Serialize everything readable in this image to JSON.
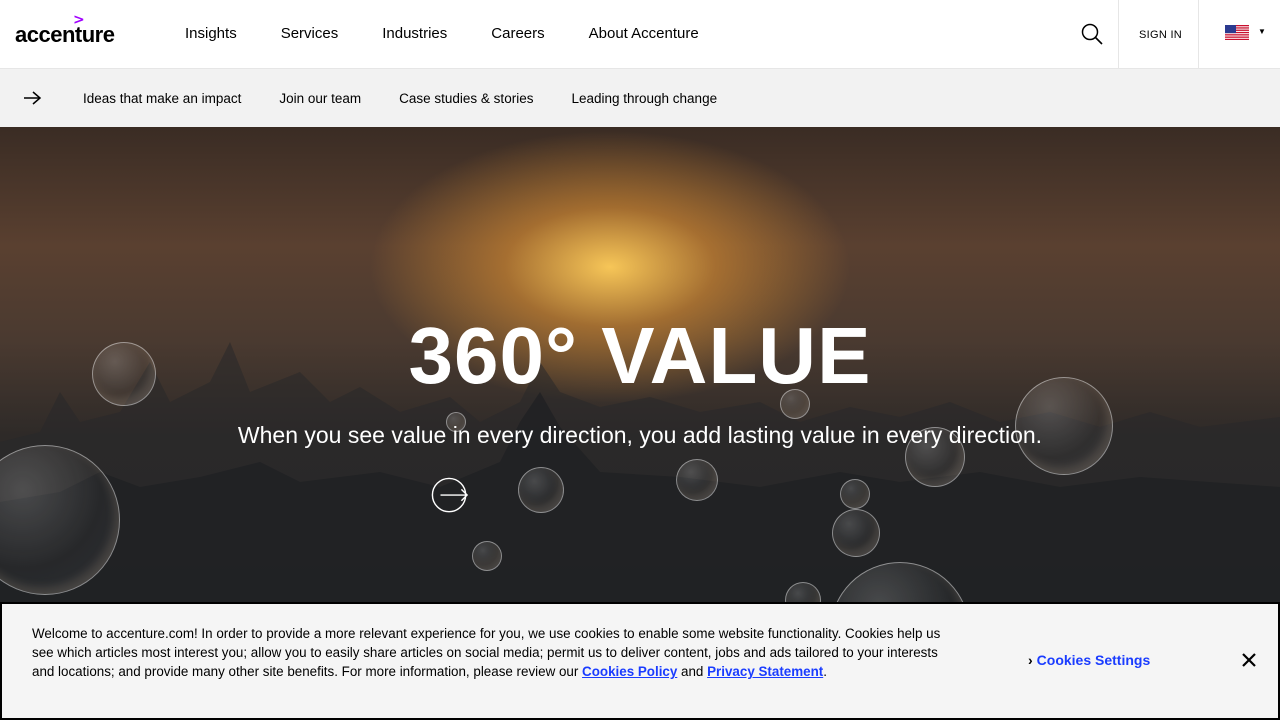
{
  "header": {
    "logo": {
      "mark": ">",
      "text": "accenture"
    },
    "nav": [
      "Insights",
      "Services",
      "Industries",
      "Careers",
      "About Accenture"
    ],
    "search_icon": "search-icon",
    "signin_label": "SIGN IN",
    "locale_icon": "us-flag-icon"
  },
  "subnav": {
    "arrow_icon": "arrow-right-icon",
    "items": [
      "Ideas that make an impact",
      "Join our team",
      "Case studies & stories",
      "Leading through change"
    ]
  },
  "hero": {
    "title": "360° VALUE",
    "subtitle": "When you see value in every direction, you add lasting value in every direction.",
    "cta_icon": "circle-arrow-right-icon"
  },
  "cookie_banner": {
    "text_part1": "Welcome to accenture.com! In order to provide a more relevant experience for you, we use cookies to enable some website functionality. Cookies help us see which articles most interest you; allow you to easily share articles on social media; permit us to deliver content, jobs and ads tailored to your interests and locations; and provide many other site benefits. For more information, please review our ",
    "cookies_policy_link": "Cookies Policy",
    "and": " and ",
    "privacy_link": "Privacy Statement",
    "period": ".",
    "settings_label": "Cookies Settings",
    "close_icon": "close-icon"
  },
  "colors": {
    "brand_purple": "#a100ff",
    "link_blue": "#1a3cff",
    "subnav_bg": "#f2f2f2"
  }
}
